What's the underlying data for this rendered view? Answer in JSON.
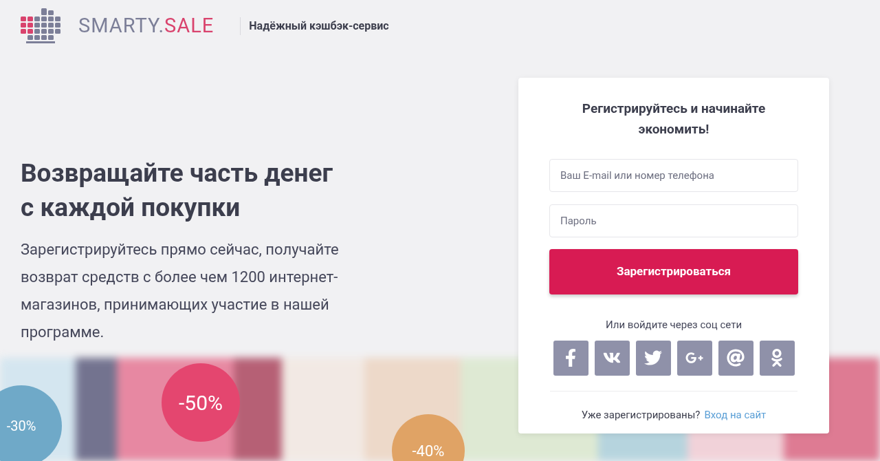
{
  "header": {
    "logo": [
      "SMARTY.",
      "SALE"
    ],
    "tagline": "Надёжный кэшбэк-сервис"
  },
  "hero": {
    "heading": "Возвращайте часть денег с каждой покупки",
    "text": "Зарегистрируйтесь прямо сейчас, получайте возврат средств с более чем 1200 интернет-магазинов, принимающих участие в нашей программе."
  },
  "badges": [
    {
      "label": "-30%",
      "color": "#6fa9c8"
    },
    {
      "label": "-50%",
      "color": "#e4466f"
    },
    {
      "label": "-40%",
      "color": "#e0a365"
    }
  ],
  "form": {
    "title": "Регистрируйтесь и начинайте экономить!",
    "fields": [
      {
        "placeholder": "Ваш E-mail или номер телефона"
      },
      {
        "placeholder": "Пароль"
      }
    ],
    "submit": "Зарегистрироваться",
    "social_caption": "Или войдите через соц сети",
    "socials": [
      {
        "kind": "facebook"
      },
      {
        "kind": "vk"
      },
      {
        "kind": "twitter"
      },
      {
        "kind": "googleplus"
      },
      {
        "kind": "mail"
      },
      {
        "kind": "ok"
      }
    ],
    "login_prompt": "Уже зарегистрированы?",
    "login_link": "Вход на сайт"
  }
}
